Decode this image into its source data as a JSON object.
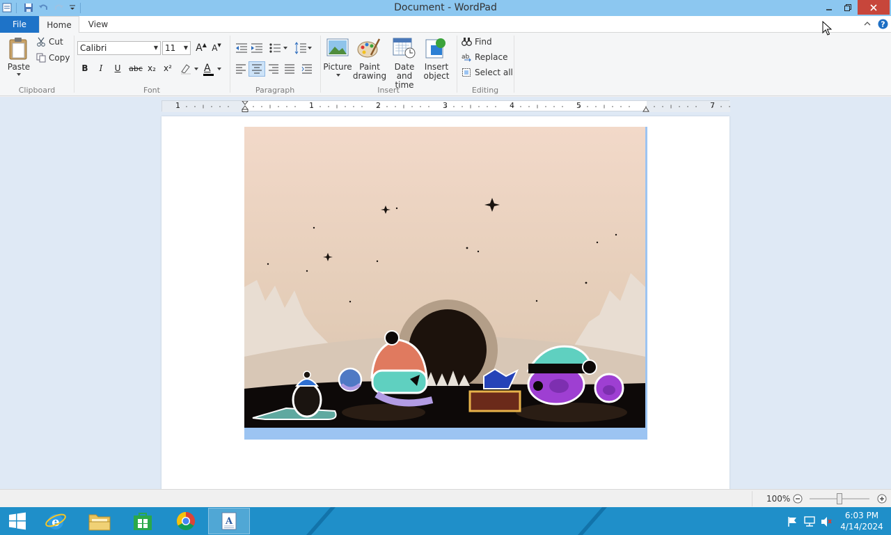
{
  "window": {
    "title": "Document - WordPad"
  },
  "tabs": {
    "file": "File",
    "home": "Home",
    "view": "View"
  },
  "ribbon": {
    "clipboard": {
      "label": "Clipboard",
      "paste": "Paste",
      "cut": "Cut",
      "copy": "Copy"
    },
    "font": {
      "label": "Font",
      "family": "Calibri",
      "size": "11",
      "bold": "B",
      "italic": "I",
      "underline": "U",
      "strikethrough": "abc",
      "subscript": "x₂",
      "superscript": "x²",
      "grow": "A",
      "shrink": "A",
      "color_letter": "A"
    },
    "paragraph": {
      "label": "Paragraph"
    },
    "insert": {
      "label": "Insert",
      "picture": "Picture",
      "paint_line1": "Paint",
      "paint_line2": "drawing",
      "datetime_line1": "Date and",
      "datetime_line2": "time",
      "object_line1": "Insert",
      "object_line2": "object"
    },
    "editing": {
      "label": "Editing",
      "find": "Find",
      "replace": "Replace",
      "select_all": "Select all"
    }
  },
  "ruler": {
    "numbers": [
      "1",
      "1",
      "2",
      "3",
      "4",
      "5",
      "7"
    ]
  },
  "status": {
    "zoom": "100%",
    "zoom_level": 1.0
  },
  "taskbar": {
    "time": "6:03 PM",
    "date": "4/14/2024"
  },
  "colors": {
    "title_bar": "#8cc7f0",
    "file_tab": "#1e73c8",
    "close_button": "#c7463b",
    "taskbar": "#1f8fc9",
    "workarea": "#dfe9f5",
    "selection": "#9cc4f2"
  }
}
